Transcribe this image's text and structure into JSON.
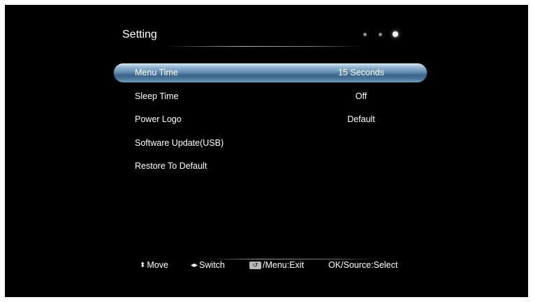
{
  "header": {
    "title": "Setting",
    "page_indicator": {
      "count": 3,
      "active_index": 2
    }
  },
  "menu": {
    "selected_index": 0,
    "items": [
      {
        "label": "Menu Time",
        "value": "15 Seconds"
      },
      {
        "label": "Sleep Time",
        "value": "Off"
      },
      {
        "label": "Power Logo",
        "value": "Default"
      },
      {
        "label": "Software Update(USB)",
        "value": ""
      },
      {
        "label": "Restore To Default",
        "value": ""
      }
    ]
  },
  "footer": {
    "move": {
      "icon": "up-down-arrows-icon",
      "glyph": "⬍",
      "label": "Move"
    },
    "switch": {
      "icon": "left-right-arrows-icon",
      "glyph": "◂▸",
      "label": "Switch"
    },
    "exit": {
      "icon": "back-key-icon",
      "glyph": "↺",
      "label": "/Menu:Exit"
    },
    "select": {
      "label": "OK/Source:Select"
    }
  },
  "colors": {
    "background": "#000000",
    "text": "#ffffff",
    "highlight": "#5f89ae",
    "inactive_dot": "#8c8c8c"
  }
}
